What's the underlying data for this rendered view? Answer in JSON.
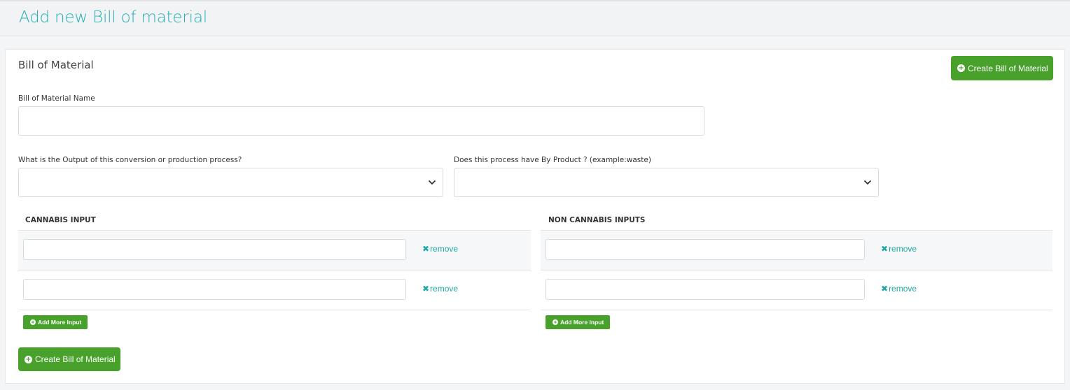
{
  "page": {
    "title": "Add new Bill of material"
  },
  "panel": {
    "title": "Bill of Material"
  },
  "actions": {
    "create_label": "Create Bill of Material"
  },
  "form": {
    "name_label": "Bill of Material Name",
    "name_value": "",
    "output_label": "What is the Output of this conversion or production process?",
    "output_value": "",
    "byproduct_label": "Does this process have By Product ? (example:waste)",
    "byproduct_value": ""
  },
  "cannabis": {
    "header": "CANNABIS INPUT",
    "rows": [
      {
        "value": "",
        "remove_label": "remove"
      },
      {
        "value": "",
        "remove_label": "remove"
      }
    ],
    "add_label": "Add More Input"
  },
  "noncannabis": {
    "header": "NON CANNABIS INPUTS",
    "rows": [
      {
        "value": "",
        "remove_label": "remove"
      },
      {
        "value": "",
        "remove_label": "remove"
      }
    ],
    "add_label": "Add More Input"
  },
  "colors": {
    "accent": "#25b0b8",
    "button": "#47a12a",
    "link": "#20a9a4"
  },
  "icons": {
    "plus": "plus-circle-icon",
    "remove": "times-icon",
    "select": "chevron-down-icon"
  }
}
